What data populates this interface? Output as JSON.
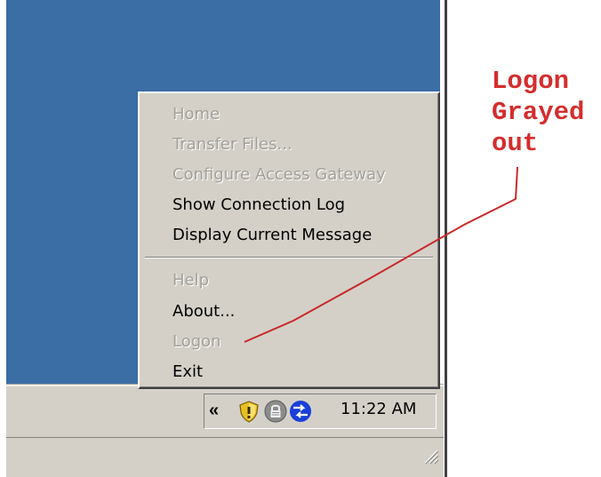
{
  "context_menu": {
    "items": [
      {
        "label": "Home",
        "enabled": false
      },
      {
        "label": "Transfer Files...",
        "enabled": false
      },
      {
        "label": "Configure Access Gateway",
        "enabled": false
      },
      {
        "label": "Show Connection Log",
        "enabled": true
      },
      {
        "label": "Display Current Message",
        "enabled": true
      },
      {
        "label": "Help",
        "enabled": false
      },
      {
        "label": "About...",
        "enabled": true
      },
      {
        "label": "Logon",
        "enabled": false
      },
      {
        "label": "Exit",
        "enabled": true
      }
    ]
  },
  "system_tray": {
    "chevron": "«",
    "icons": [
      "shield-warning-icon",
      "lock-icon",
      "network-arrows-icon"
    ],
    "clock": "11:22 AM"
  },
  "annotation": {
    "lines": [
      "Logon",
      "Grayed",
      "out"
    ],
    "color": "#d42d2d"
  },
  "colors": {
    "desktop": "#3a6ea5",
    "menu_background": "#d4d0c8",
    "disabled_text": "#a3a09a"
  }
}
